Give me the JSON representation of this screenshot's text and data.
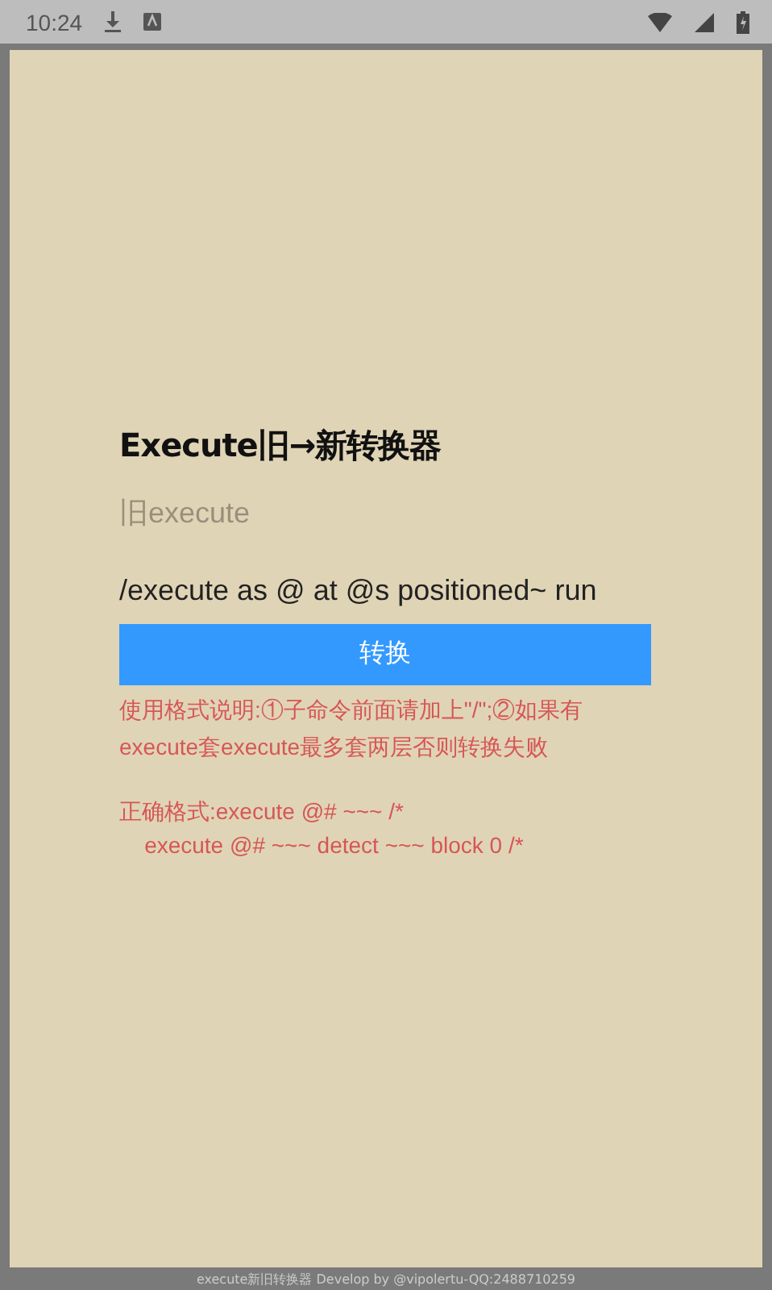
{
  "status_bar": {
    "time": "10:24"
  },
  "title": "Execute旧→新转换器",
  "input": {
    "placeholder": "旧execute"
  },
  "output": "/execute as @ at @s positioned~ run",
  "convert_button": "转换",
  "notes": [
    "使用格式说明:①子命令前面请加上\"/\";②如果有execute套execute最多套两层否则转换失败",
    "正确格式:execute @# ~~~ /*\n    execute @# ~~~ detect ~~~ block 0 /*"
  ],
  "footer": "execute新旧转换器 Develop by @vipolertu-QQ:2488710259"
}
